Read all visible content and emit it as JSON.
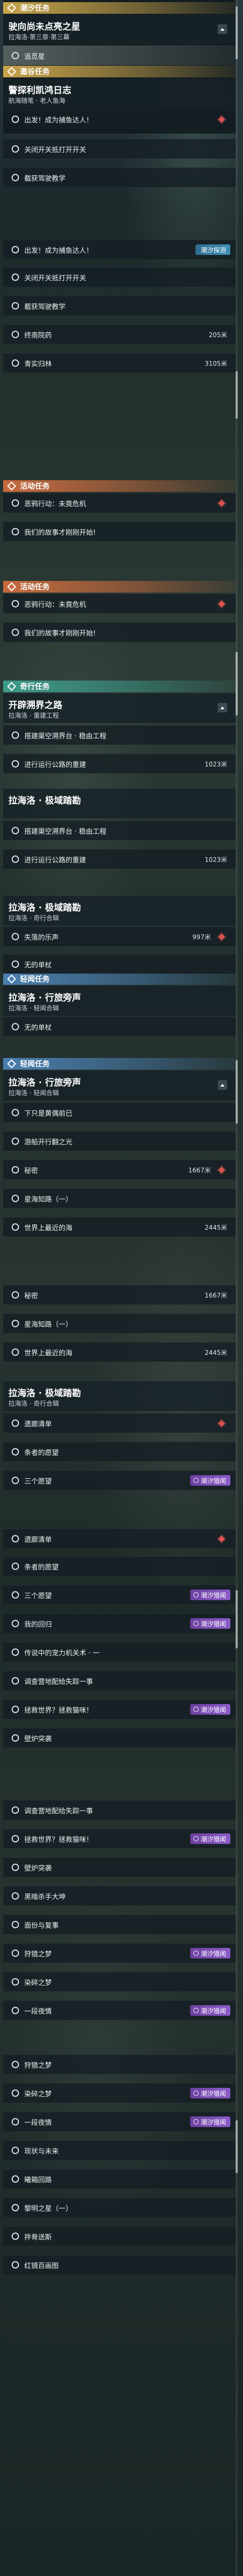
{
  "sections": {
    "sea_route": "潮汐任务",
    "pursuit": "邀谷任务",
    "activity": "活动任务",
    "wander": "奇行任务",
    "rumor": "轻闻任务"
  },
  "quests": {
    "q1": {
      "title": "驶向尚未点亮之星",
      "sub": "拉海洛·第三章·第三幕"
    },
    "q2": {
      "title": "警探利凯鸿日志",
      "sub": "航海随笔 · 老人鱼海"
    },
    "q3": {
      "title": "开辟溯界之路",
      "sub": "拉海洛 · 重建工程"
    },
    "q4": {
      "title": "拉海洛 · 极域踏勘",
      "sub": "拉海洛 · 奇行合辑"
    },
    "q5": {
      "title": "拉海洛 · 极域踏勘",
      "sub": "拉海洛 · 奇行合辑"
    },
    "q6": {
      "title": "拉海洛 · 行旅旁声",
      "sub": "拉海洛 · 轻闻合辑"
    },
    "q7": {
      "title": "拉海洛 · 行旅旁声",
      "sub": "拉海洛 · 轻闻合辑"
    },
    "q8": {
      "title": "拉海洛 · 极域踏勘",
      "sub": "拉海洛 · 奇行合辑"
    }
  },
  "badges": {
    "resonance": "潮汐探测",
    "seek": "潮汐猎闻"
  },
  "rows": [
    {
      "label": "追觅星",
      "dist": ""
    },
    {
      "label": "出发！成为捕鱼达人！",
      "dist": ""
    },
    {
      "label": "关闭开关抵打开开关",
      "dist": ""
    },
    {
      "label": "截获驾驶教学",
      "dist": ""
    },
    {
      "label": "出发！成为捕鱼达人！",
      "dist": ""
    },
    {
      "label": "关闭开关抵打开开关",
      "dist": ""
    },
    {
      "label": "截获驾驶教学",
      "dist": ""
    },
    {
      "label": "终南院药",
      "dist": "205米"
    },
    {
      "label": "青实归林",
      "dist": "3105米"
    },
    {
      "label": "恶鸦行动：未竟危机",
      "dist": ""
    },
    {
      "label": "我们的故事才刚刚开始!",
      "dist": ""
    },
    {
      "label": "恶鸦行动：未竟危机",
      "dist": ""
    },
    {
      "label": "我们的故事才刚刚开始!",
      "dist": ""
    },
    {
      "label": "搭建渠空溯界台 · 稳由工程",
      "dist": ""
    },
    {
      "label": "进行运行公路的重建",
      "dist": "1023米"
    },
    {
      "label": "搭建渠空溯界台 · 稳由工程",
      "dist": ""
    },
    {
      "label": "进行运行公路的重建",
      "dist": "1023米"
    },
    {
      "label": "失落的乐声",
      "dist": "997米"
    },
    {
      "label": "无的单杖",
      "dist": ""
    },
    {
      "label": "无的单杖",
      "dist": ""
    },
    {
      "label": "下只是黄偶前已",
      "dist": ""
    },
    {
      "label": "游船开行翻之光",
      "dist": ""
    },
    {
      "label": "秘密",
      "dist": "1667米"
    },
    {
      "label": "星海知路（一）",
      "dist": ""
    },
    {
      "label": "世界上最近的海",
      "dist": "2445米"
    },
    {
      "label": "秘密",
      "dist": "1667米"
    },
    {
      "label": "星海知路（一）",
      "dist": ""
    },
    {
      "label": "世界上最近的海",
      "dist": "2445米"
    },
    {
      "label": "遗廊清单",
      "dist": ""
    },
    {
      "label": "条者的愿望",
      "dist": ""
    },
    {
      "label": "三个愿望",
      "dist": ""
    },
    {
      "label": "遗廊清单",
      "dist": ""
    },
    {
      "label": "条者的愿望",
      "dist": ""
    },
    {
      "label": "三个愿望",
      "dist": ""
    },
    {
      "label": "我的回归",
      "dist": ""
    },
    {
      "label": "传说中的宠力机关术 · 一",
      "dist": ""
    },
    {
      "label": "调查营地配给失踪一事",
      "dist": ""
    },
    {
      "label": "拯救世界？拯救猫咪！",
      "dist": ""
    },
    {
      "label": "壁炉突袭",
      "dist": ""
    },
    {
      "label": "调查营地配给失踪一事",
      "dist": ""
    },
    {
      "label": "拯救世界？拯救猫咪！",
      "dist": ""
    },
    {
      "label": "壁炉突袭",
      "dist": ""
    },
    {
      "label": "黑暗杀手大坤",
      "dist": ""
    },
    {
      "label": "面份与复事",
      "dist": ""
    },
    {
      "label": "狩猎之梦",
      "dist": ""
    },
    {
      "label": "染碎之梦",
      "dist": ""
    },
    {
      "label": "一段夜情",
      "dist": ""
    },
    {
      "label": "狩猎之梦",
      "dist": ""
    },
    {
      "label": "染碎之梦",
      "dist": ""
    },
    {
      "label": "一段夜情",
      "dist": ""
    },
    {
      "label": "现状与未来",
      "dist": ""
    },
    {
      "label": "曦箱回路",
      "dist": ""
    },
    {
      "label": "黎明之星（一）",
      "dist": ""
    },
    {
      "label": "拌骨送斯",
      "dist": ""
    },
    {
      "label": "红镜百画图",
      "dist": ""
    }
  ]
}
